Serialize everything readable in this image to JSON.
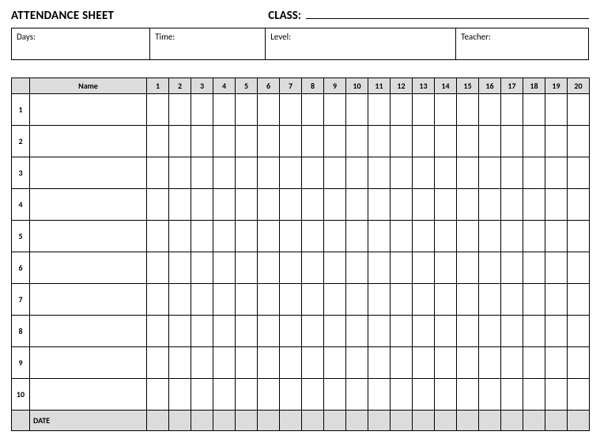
{
  "title": "ATTENDANCE SHEET",
  "class_label": "CLASS:",
  "info": {
    "days": "Days:",
    "time": "Time:",
    "level": "Level:",
    "teacher": "Teacher:"
  },
  "table": {
    "name_header": "Name",
    "date_label": "DATE",
    "session_headers": [
      "1",
      "2",
      "3",
      "4",
      "5",
      "6",
      "7",
      "8",
      "9",
      "10",
      "11",
      "12",
      "13",
      "14",
      "15",
      "16",
      "17",
      "18",
      "19",
      "20"
    ],
    "row_numbers": [
      "1",
      "2",
      "3",
      "4",
      "5",
      "6",
      "7",
      "8",
      "9",
      "10"
    ]
  }
}
